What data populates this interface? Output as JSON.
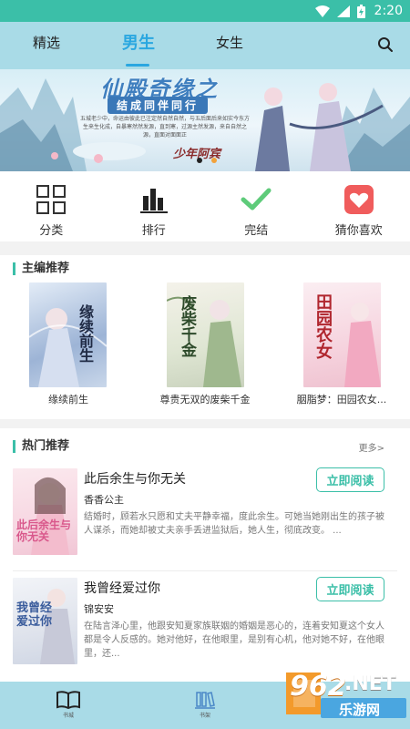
{
  "status_bar": {
    "time": "2:20"
  },
  "header": {
    "tabs": [
      {
        "label": "精选"
      },
      {
        "label": "男生",
        "active": true
      },
      {
        "label": "女生"
      }
    ]
  },
  "banner": {
    "title": "仙殿奇缘之",
    "subtitle": "结成同伴同行",
    "description": "五城老少中，命运由彼此已注定然自然自然，与五后面后来如实今东方生来生化成，自暴寒然然发源，直到寒，过源主然发源，来自自然之源，直面对面面正",
    "author": "少年阿宾"
  },
  "quick_nav": [
    {
      "label": "分类",
      "icon": "grid-icon"
    },
    {
      "label": "排行",
      "icon": "bar-chart-icon"
    },
    {
      "label": "完结",
      "icon": "check-icon"
    },
    {
      "label": "猜你喜欢",
      "icon": "heart-icon"
    }
  ],
  "editor_picks": {
    "title": "主编推荐",
    "books": [
      {
        "title": "缘续前生",
        "cover_text": "缘续前生"
      },
      {
        "title": "尊贵无双的废柴千金",
        "cover_text": "废柴千金"
      },
      {
        "title": "胭脂梦：田园农女...",
        "cover_text": "田园农女"
      }
    ]
  },
  "hot_picks": {
    "title": "热门推荐",
    "more": "更多>",
    "items": [
      {
        "title": "此后余生与你无关",
        "author": "香香公主",
        "desc": "结婚时，顾若水只愿和丈夫平静幸福，度此余生。可她当她刚出生的孩子被人谋杀，而她却被丈夫亲手丢进监狱后，她人生，彻底改变。 ...",
        "button": "立即阅读",
        "cover_text": "此后余生与你无关"
      },
      {
        "title": "我曾经爱过你",
        "author": "锦安安",
        "desc": "在陆言泽心里，他跟安知夏家族联姻的婚姻是恶心的，连着安知夏这个女人都是令人反感的。她对他好，在他眼里，是别有心机，他对她不好，在他眼里，还...",
        "button": "立即阅读",
        "cover_text": "我曾经爱过你"
      }
    ]
  },
  "bottom_nav": [
    {
      "label": "书城",
      "icon": "book-icon"
    },
    {
      "label": "书架",
      "icon": "bookshelf-icon"
    },
    {
      "label": "",
      "icon": "user-icon"
    }
  ],
  "watermark": {
    "brand": "962",
    "net": ".NET",
    "sub": "乐游网"
  },
  "colors": {
    "accent": "#3bbfa8",
    "header_bg": "#a9dbe7",
    "active_tab": "#2aa7e0",
    "heart": "#f05c5c"
  }
}
